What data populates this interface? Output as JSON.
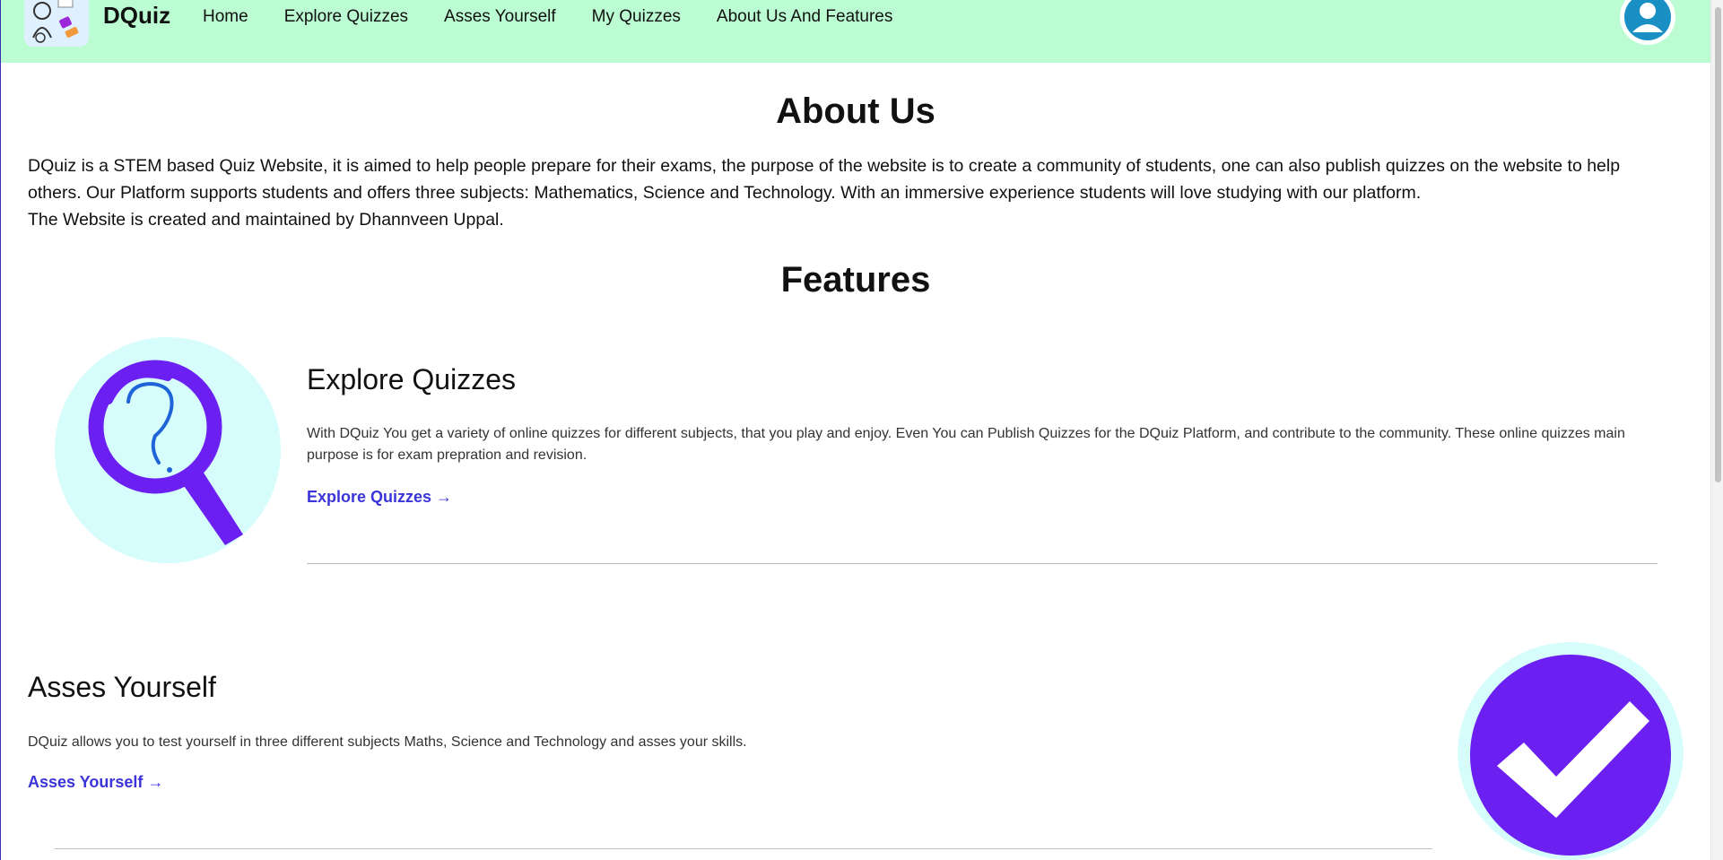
{
  "navbar": {
    "brand": "DQuiz",
    "links": [
      "Home",
      "Explore Quizzes",
      "Asses Yourself",
      "My Quizzes",
      "About Us And Features"
    ]
  },
  "about": {
    "title": "About Us",
    "paragraph": "DQuiz is a STEM based Quiz Website, it is aimed to help people prepare for their exams, the purpose of the website is to create a community of students, one can also publish quizzes on the website to help others. Our Platform supports students and offers three subjects: Mathematics, Science and Technology. With an immersive experience students will love studying with our platform.",
    "credit": "The Website is created and maintained by Dhannveen Uppal."
  },
  "features": {
    "title": "Features",
    "items": [
      {
        "heading": "Explore Quizzes",
        "description": "With DQuiz You get a variety of online quizzes for different subjects, that you play and enjoy. Even You can Publish Quizzes for the DQuiz Platform, and contribute to the community. These online quizzes main purpose is for exam prepration and revision.",
        "link": "Explore Quizzes →",
        "icon": "magnifier-question-icon"
      },
      {
        "heading": "Asses Yourself",
        "description": "DQuiz allows you to test yourself in three different subjects Maths, Science and Technology and asses your skills.",
        "link": "Asses Yourself →",
        "icon": "checkmark-circle-icon"
      }
    ]
  },
  "colors": {
    "navbar_bg": "#bbfcd2",
    "accent_purple": "#6b1ff0",
    "link_blue": "#3b35d9",
    "icon_bg": "#d6fcfc",
    "avatar_blue": "#1a8fc4"
  }
}
